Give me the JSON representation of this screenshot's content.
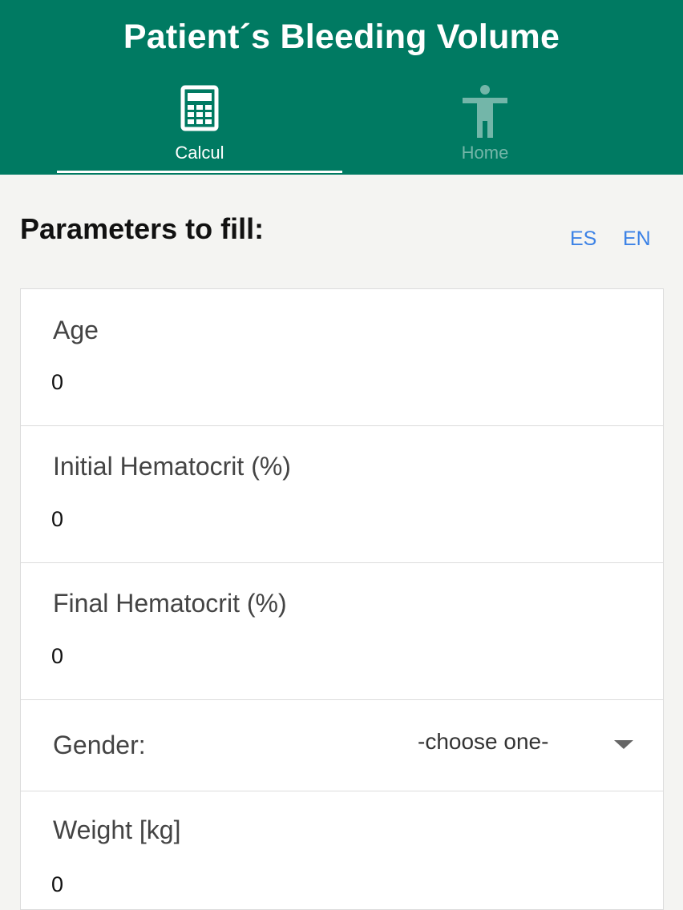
{
  "header": {
    "title": "Patient´s Bleeding Volume",
    "background": "#007a62",
    "tabs": [
      {
        "label": "Calcul",
        "icon": "calculator-icon",
        "active": true
      },
      {
        "label": "Home",
        "icon": "person-icon",
        "active": false
      }
    ]
  },
  "main": {
    "heading": "Parameters to fill:",
    "languages": [
      "ES",
      "EN"
    ],
    "fields": {
      "age": {
        "label": "Age",
        "value": "0"
      },
      "initial_hematocrit": {
        "label": "Initial Hematocrit (%)",
        "value": "0"
      },
      "final_hematocrit": {
        "label": "Final Hematocrit (%)",
        "value": "0"
      },
      "gender": {
        "label": "Gender:",
        "selected": "-choose one-"
      },
      "weight": {
        "label": "Weight [kg]",
        "value": "0"
      }
    }
  }
}
